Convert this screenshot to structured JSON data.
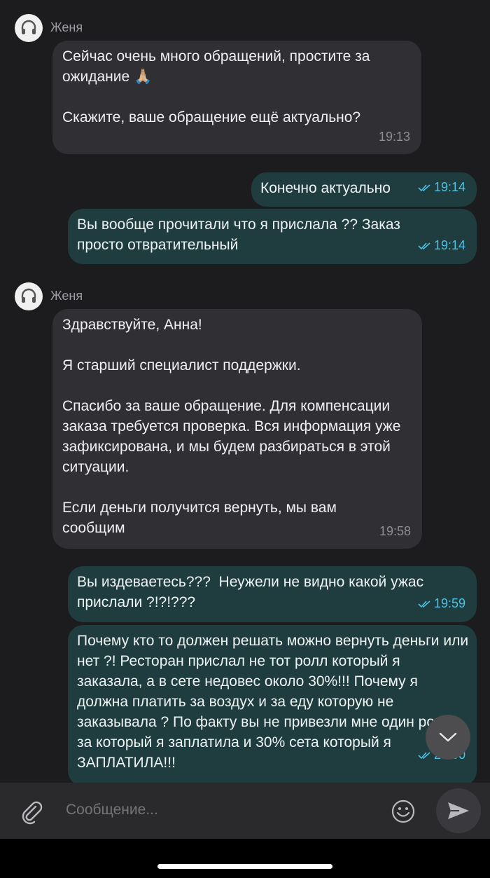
{
  "messages": [
    {
      "sender": "Женя",
      "paragraphs": [
        "Сейчас очень много обращений, простите за ожидание 🙏🏼",
        "Скажите, ваше обращение ещё актуально?"
      ],
      "time": "19:13"
    },
    {
      "text": "Конечно актуально",
      "time": "19:14"
    },
    {
      "text": "Вы вообще прочитали что я прислала ?? Заказ просто отвратительный",
      "time": "19:14"
    },
    {
      "sender": "Женя",
      "paragraphs": [
        "Здравствуйте, Анна!",
        "Я старший специалист поддержки.",
        "Спасибо за ваше обращение. Для компенсации заказа требуется проверка. Вся информация уже зафиксирована, и мы будем разбираться в этой ситуации.",
        "Если деньги получится вернуть, мы вам сообщим"
      ],
      "time": "19:58"
    },
    {
      "text": "Вы издеваетесь???  Неужели не видно какой ужас прислали ?!?!???",
      "time": "19:59"
    },
    {
      "text": "Почему кто то должен решать можно вернуть деньги или нет ?! Ресторан прислал не тот ролл который я заказала, а в сете недовес около 30%!!! Почему я должна платить за воздух и за еду которую не заказывала ? По факту вы не привезли мне один ролл за который я заплатила и 30% сета который я ЗАПЛАТИЛА!!!",
      "time": "20:00"
    }
  ],
  "composer": {
    "placeholder": "Сообщение...",
    "attach_icon": "paperclip-icon",
    "emoji_icon": "smiley-icon",
    "send_icon": "send-icon"
  },
  "scroll_down_icon": "chevron-down-icon",
  "colors": {
    "background": "#1c1c1e",
    "incoming_bubble": "#2f2f34",
    "outgoing_bubble": "#1f3c3e",
    "read_receipt": "#4cc3e6"
  }
}
